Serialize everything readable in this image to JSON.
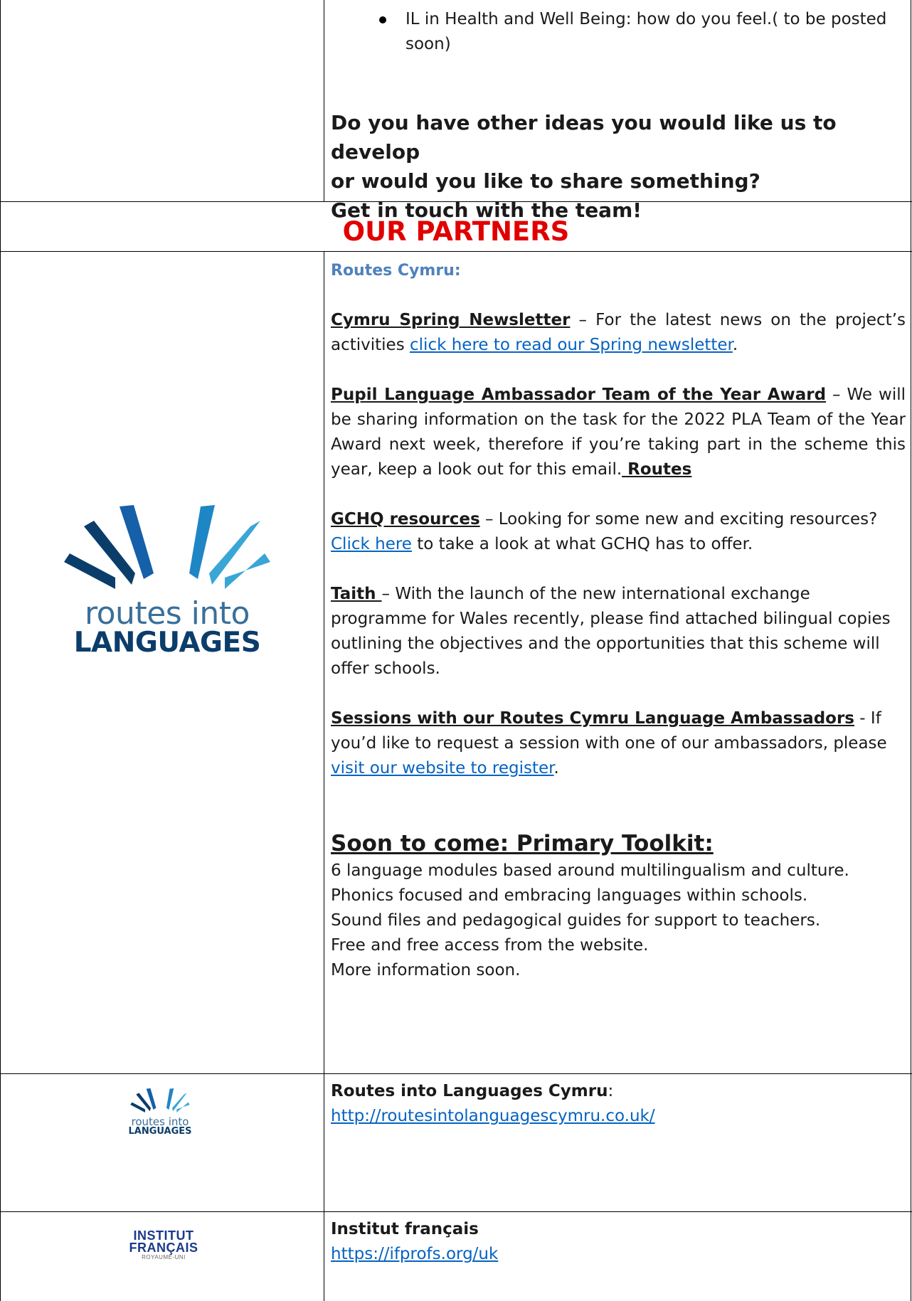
{
  "row1": {
    "bullet": "IL in Health and Well Being: how do you feel.( to be posted soon)",
    "question_line1": "Do you have other ideas you would like us to develop",
    "question_line2": "or would you like to share something?",
    "question_line3": "Get in touch with the team!"
  },
  "partners": {
    "heading": "OUR PARTNERS"
  },
  "routes_cymru": {
    "label": "Routes Cymru:",
    "newsletter_title": "Cymru Spring Newsletter",
    "newsletter_text": " – For the latest news on the project’s activities ",
    "newsletter_link": "click here to read our Spring newsletter",
    "newsletter_end": ".",
    "pla_title": "Pupil Language Ambassador Team of the Year Award",
    "pla_text": " – We will be sharing information on the task for the 2022 PLA Team of the Year Award next week, therefore if you’re taking part in the scheme this year, keep a look out for this email.",
    "pla_routes": " Routes",
    "gchq_title": "GCHQ resources",
    "gchq_text1": " – Looking for some new and exciting resources?  ",
    "gchq_link": "Click here",
    "gchq_text2": " to take a look at what GCHQ has to offer.",
    "taith_title": "Taith ",
    "taith_text": "– With the launch of the new international exchange programme for Wales recently, please find attached bilingual copies outlining the objectives and the opportunities that this scheme will offer schools.",
    "sessions_title": "Sessions with our Routes Cymru Language Ambassadors",
    "sessions_text": " - If you’d like to request a session with one of our ambassadors, please ",
    "sessions_link": "visit our website to register",
    "sessions_end": ".",
    "toolkit_heading": "Soon to come: Primary Toolkit:",
    "toolkit_lines": [
      "6 language modules based around multilingualism and culture.",
      "Phonics focused and embracing languages within schools.",
      "Sound files and pedagogical guides for support to teachers.",
      "Free and free access from the website.",
      "More information soon."
    ]
  },
  "logo_routes": {
    "word1": "routes into",
    "word2": "LANGUAGES",
    "colors": [
      "#0b3d6b",
      "#1560a8",
      "#1f86c6",
      "#3aa6d6"
    ]
  },
  "rows": [
    {
      "org": "Routes into Languages Cymru",
      "org_suffix": ":",
      "url": "http://routesintolanguagescymru.co.uk/"
    },
    {
      "org": "Institut français",
      "url": "https://ifprofs.org/uk"
    }
  ],
  "logo_if": {
    "line1": "INSTITUT",
    "line2": "FRANÇAIS",
    "line3": "ROYAUME-UNI"
  }
}
